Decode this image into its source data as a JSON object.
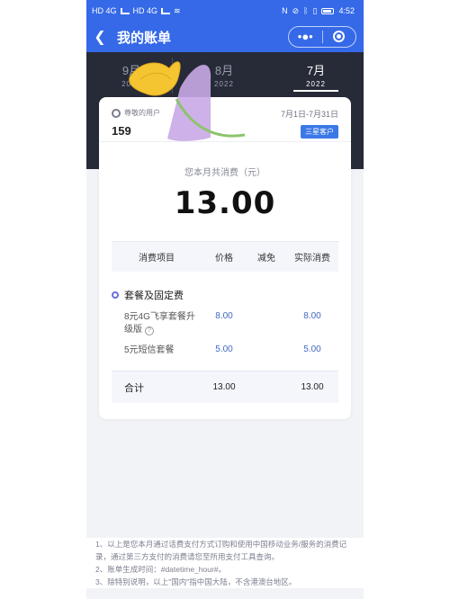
{
  "status_bar": {
    "carrier_left": "HD 4G",
    "carrier_right": "HD 4G",
    "time": "4:52"
  },
  "navbar": {
    "title": "我的账单",
    "menu_icon": "more-dots-icon",
    "close_icon": "close-target-icon"
  },
  "months": [
    {
      "label": "9月",
      "year": "2022",
      "active": false
    },
    {
      "label": "8月",
      "year": "2022",
      "active": false
    },
    {
      "label": "7月",
      "year": "2022",
      "active": true
    }
  ],
  "customer": {
    "greeting": "尊敬的用户",
    "phone": "159",
    "period": "7月1日-7月31日",
    "tier": "三星客户"
  },
  "summary": {
    "label": "您本月共消费（元）",
    "amount": "13.00"
  },
  "table": {
    "headers": [
      "消费项目",
      "价格",
      "减免",
      "实际消费"
    ],
    "section_title": "套餐及固定费",
    "rows": [
      {
        "name": "8元4G飞享套餐升级版",
        "price": "8.00",
        "discount": "",
        "actual": "8.00"
      },
      {
        "name": "5元短信套餐",
        "price": "5.00",
        "discount": "",
        "actual": "5.00"
      }
    ],
    "total": {
      "label": "合计",
      "price": "13.00",
      "discount": "",
      "actual": "13.00"
    }
  },
  "notes": [
    "1、以上是您本月通过话费支付方式订购和使用中国移动业务/服务的消费记录，通过第三方支付的消费请您至所用支付工具查询。",
    "2、账单生成时间：#datetime_hour#。",
    "3、除特别说明，以上\"国内\"指中国大陆，不含港澳台地区。"
  ],
  "colors": {
    "brand_blue": "#3569e8",
    "dark_band": "#272a37",
    "value_blue": "#4469c0"
  }
}
